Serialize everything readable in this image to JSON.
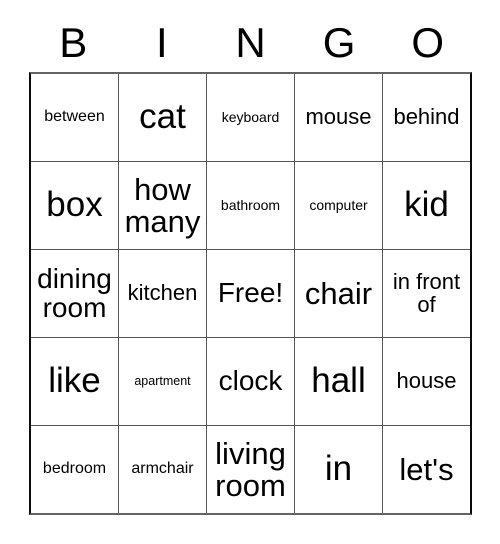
{
  "card": {
    "title": "BINGO",
    "header_letters": [
      "B",
      "I",
      "N",
      "G",
      "O"
    ],
    "free_space_label": "Free!",
    "columns": 5,
    "rows": 5,
    "colors": {
      "background": "#ffffff",
      "text": "#000000",
      "outer_border": "#0a0a0a",
      "inner_grid_line": "#555555"
    },
    "cells": [
      [
        {
          "text": "between"
        },
        {
          "text": "cat"
        },
        {
          "text": "keyboard"
        },
        {
          "text": "mouse"
        },
        {
          "text": "behind"
        }
      ],
      [
        {
          "text": "box"
        },
        {
          "text": "how many"
        },
        {
          "text": "bathroom"
        },
        {
          "text": "computer"
        },
        {
          "text": "kid"
        }
      ],
      [
        {
          "text": "dining room"
        },
        {
          "text": "kitchen"
        },
        {
          "text": "Free!"
        },
        {
          "text": "chair"
        },
        {
          "text": "in front of"
        }
      ],
      [
        {
          "text": "like"
        },
        {
          "text": "apartment"
        },
        {
          "text": "clock"
        },
        {
          "text": "hall"
        },
        {
          "text": "house"
        }
      ],
      [
        {
          "text": "bedroom"
        },
        {
          "text": "armchair"
        },
        {
          "text": "living room"
        },
        {
          "text": "in"
        },
        {
          "text": "let's"
        }
      ]
    ]
  }
}
